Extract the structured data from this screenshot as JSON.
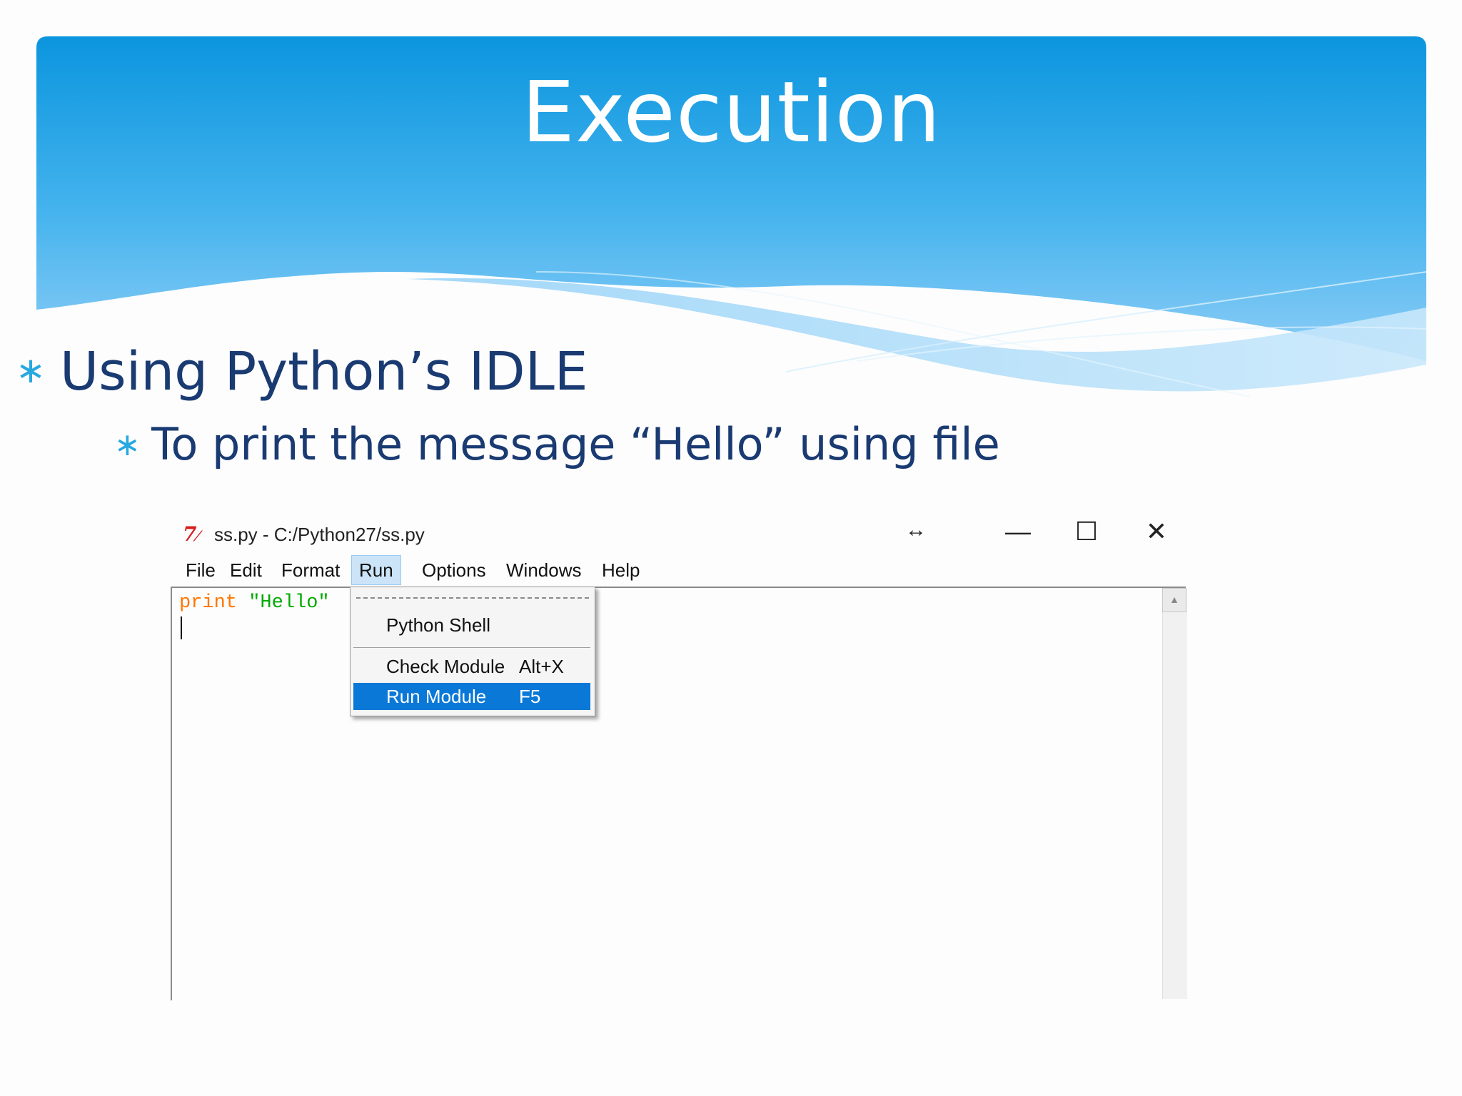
{
  "slide": {
    "title": "Execution",
    "bullets": [
      {
        "text": "Using Python’s IDLE"
      },
      {
        "text": "To print the message “Hello” using file"
      }
    ],
    "bullet_glyph": "∗"
  },
  "colors": {
    "banner_top": "#0b95de",
    "banner_bottom": "#8ecdf6",
    "bullet_text": "#1a3a72",
    "bullet_marker": "#27a8e0",
    "highlight": "#0a78d7"
  },
  "window": {
    "title": "ss.py - C:/Python27/ss.py",
    "app_icon": "tk-feather-icon",
    "controls": {
      "minimize": "—",
      "maximize": "☐",
      "close": "✕",
      "resize": "↔"
    },
    "menu": [
      "File",
      "Edit",
      "Format",
      "Run",
      "Options",
      "Windows",
      "Help"
    ],
    "active_menu": "Run",
    "editor": {
      "keyword": "print",
      "string": "\"Hello\""
    },
    "run_menu": {
      "items": [
        {
          "label": "Python Shell",
          "accel": ""
        },
        {
          "label": "Check Module",
          "accel": "Alt+X"
        },
        {
          "label": "Run Module",
          "accel": "F5",
          "selected": true
        }
      ]
    }
  }
}
